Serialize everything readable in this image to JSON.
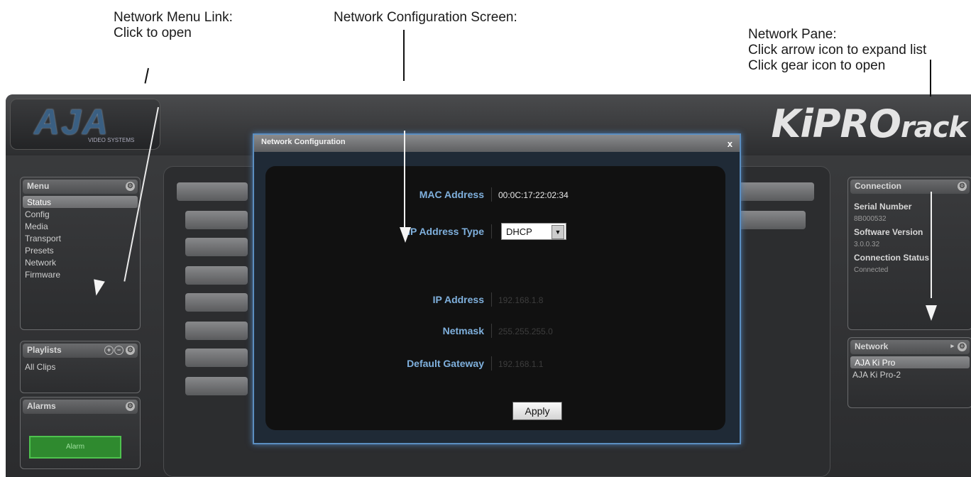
{
  "callouts": {
    "network_menu": "Network Menu Link:\nClick to open",
    "network_config": "Network Configuration Screen:",
    "network_pane": "Network Pane:\nClick arrow icon to expand list\nClick gear icon to open"
  },
  "brand": {
    "logo": "AJA",
    "logo_sub": "VIDEO SYSTEMS",
    "product": "KiPRO",
    "product_suffix": "rack"
  },
  "menu": {
    "title": "Menu",
    "items": [
      "Status",
      "Config",
      "Media",
      "Transport",
      "Presets",
      "Network",
      "Firmware"
    ],
    "active_index": 0
  },
  "playlists": {
    "title": "Playlists",
    "items": [
      "All Clips"
    ]
  },
  "alarms": {
    "title": "Alarms",
    "status": "Alarm"
  },
  "connection": {
    "title": "Connection",
    "serial_label": "Serial Number",
    "serial_value": "8B000532",
    "software_label": "Software Version",
    "software_value": "3.0.0.32",
    "status_label": "Connection Status",
    "status_value": "Connected"
  },
  "network_pane": {
    "title": "Network",
    "items": [
      "AJA Ki Pro",
      "AJA Ki Pro-2"
    ]
  },
  "dialog": {
    "title": "Network Configuration",
    "close": "x",
    "mac_label": "MAC Address",
    "mac_value": "00:0C:17:22:02:34",
    "ip_type_label": "IP Address Type",
    "ip_type_value": "DHCP",
    "ip_label": "IP Address",
    "ip_value": "192.168.1.8",
    "netmask_label": "Netmask",
    "netmask_value": "255.255.255.0",
    "gateway_label": "Default Gateway",
    "gateway_value": "192.168.1.1",
    "apply_label": "Apply"
  },
  "colors": {
    "accent": "#7fb0dd",
    "alarm_green": "#2f8a2f",
    "panel": "#2c2d2f"
  }
}
